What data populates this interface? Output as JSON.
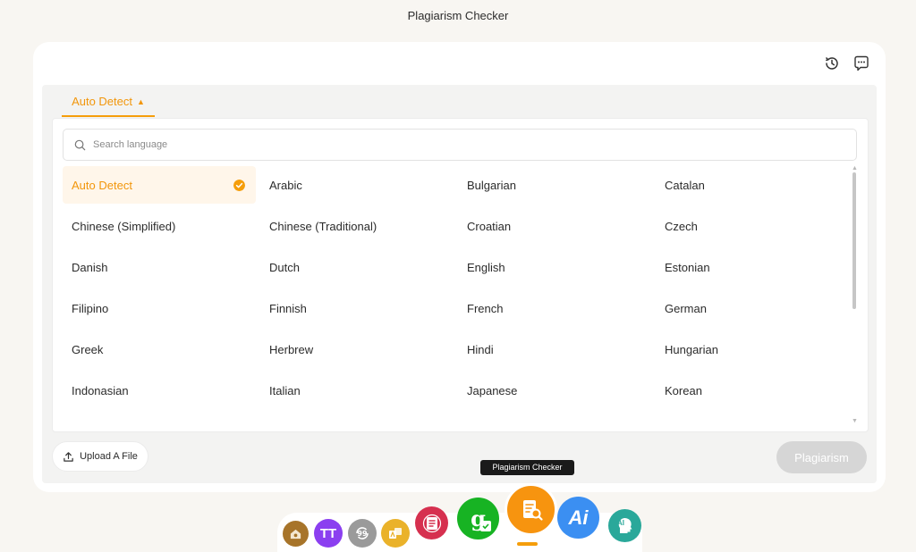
{
  "app": {
    "title": "Plagiarism Checker"
  },
  "language_tab": {
    "label": "Auto Detect"
  },
  "search": {
    "placeholder": "Search language"
  },
  "languages": [
    "Auto Detect",
    "Arabic",
    "Bulgarian",
    "Catalan",
    "Chinese (Simplified)",
    "Chinese (Traditional)",
    "Croatian",
    "Czech",
    "Danish",
    "Dutch",
    "English",
    "Estonian",
    "Filipino",
    "Finnish",
    "French",
    "German",
    "Greek",
    "Herbrew",
    "Hindi",
    "Hungarian",
    "Indonasian",
    "Italian",
    "Japanese",
    "Korean"
  ],
  "selected_language": "Auto Detect",
  "actions": {
    "upload_label": "Upload A File",
    "check_label": "Plagiarism"
  },
  "tooltip": {
    "text": "Plagiarism Checker"
  },
  "dock": {
    "apps": [
      {
        "icon": "home-app-icon",
        "color": "#a7742a"
      },
      {
        "icon": "text-size-app-icon",
        "label": "TT",
        "color": "#8b3ff0"
      },
      {
        "icon": "quote-refresh-app-icon",
        "color": "#9a9a9a"
      },
      {
        "icon": "translate-app-icon",
        "color": "#eab22a"
      },
      {
        "icon": "summarizer-app-icon",
        "color": "#d6304f"
      },
      {
        "icon": "grammar-checker-app-icon",
        "label": "g",
        "color": "#17b323"
      },
      {
        "icon": "plagiarism-checker-app-icon",
        "color": "#f7940f",
        "active": true
      },
      {
        "icon": "ai-writer-app-icon",
        "label": "Ai",
        "color": "#3b8ff2"
      },
      {
        "icon": "ai-humanizer-app-icon",
        "label": "AI",
        "color": "#2aa89a"
      }
    ]
  },
  "colors": {
    "accent": "#f59e0b",
    "page_bg": "#f8f6f2",
    "disabled_button": "#d6d6d6"
  }
}
